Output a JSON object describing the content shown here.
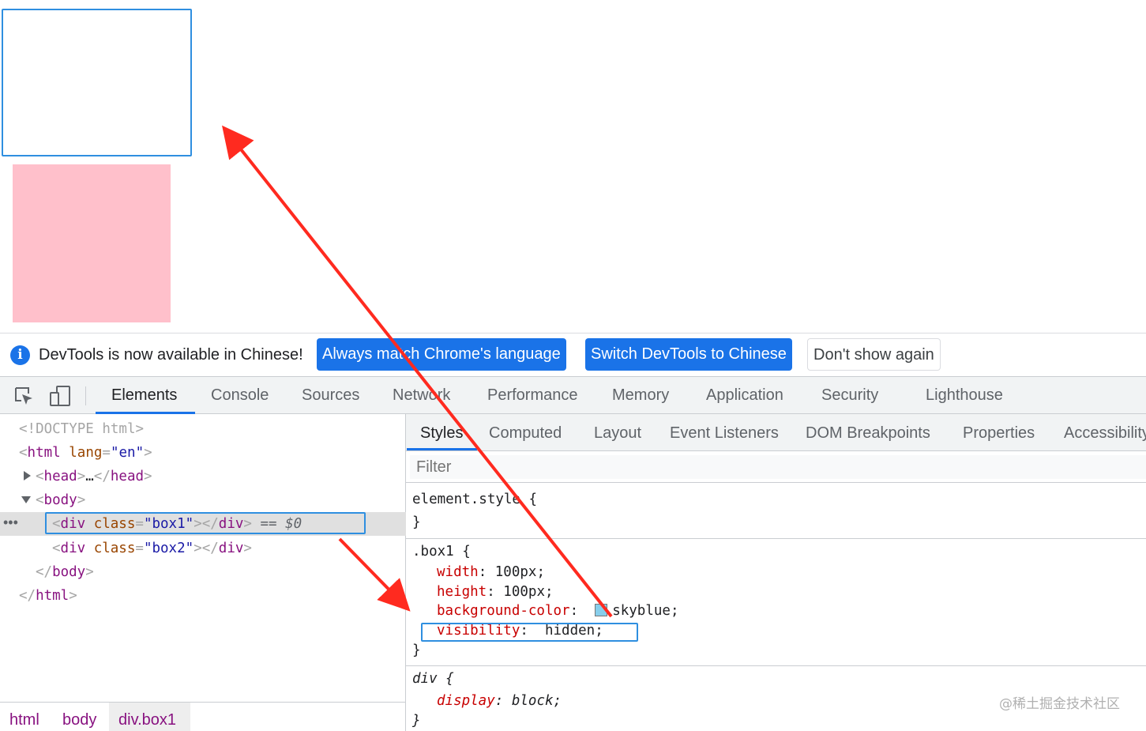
{
  "preview": {
    "box2_color": "#ffc0cb",
    "highlight_color": "#2f8fe0"
  },
  "infobar": {
    "icon": "info-icon",
    "message": "DevTools is now available in Chinese!",
    "btn_match": "Always match Chrome's language",
    "btn_switch": "Switch DevTools to Chinese",
    "btn_dismiss": "Don't show again",
    "primary_color": "#1a73e8"
  },
  "toolbar": {
    "inspect_icon": "inspect-element-icon",
    "device_icon": "device-toolbar-icon",
    "tabs": [
      "Elements",
      "Console",
      "Sources",
      "Network",
      "Performance",
      "Memory",
      "Application",
      "Security",
      "Lighthouse"
    ],
    "active_tab": "Elements",
    "accent_color": "#1a73e8"
  },
  "dom": {
    "doctype": "<!DOCTYPE html>",
    "html_open": {
      "tag": "html",
      "attr": "lang",
      "value": "en"
    },
    "head": {
      "tag": "head",
      "ellipsis": "…"
    },
    "body_open": "body",
    "selected": {
      "tag": "div",
      "attr": "class",
      "value": "box1",
      "marker": "== $0"
    },
    "second": {
      "tag": "div",
      "attr": "class",
      "value": "box2"
    },
    "body_close": "body",
    "html_close": "html",
    "gutter_dots": "•••"
  },
  "breadcrumbs": [
    "html",
    "body",
    "div.box1"
  ],
  "styles": {
    "sub_tabs": [
      "Styles",
      "Computed",
      "Layout",
      "Event Listeners",
      "DOM Breakpoints",
      "Properties",
      "Accessibility"
    ],
    "active_sub_tab": "Styles",
    "filter_placeholder": "Filter",
    "element_style_selector": "element.style",
    "box1": {
      "selector": ".box1",
      "declarations": [
        {
          "prop": "width",
          "value": "100px"
        },
        {
          "prop": "height",
          "value": "100px"
        },
        {
          "prop": "background-color",
          "value": "skyblue",
          "swatch": "#87ceeb"
        },
        {
          "prop": "visibility",
          "value": "hidden"
        }
      ]
    },
    "div_rule": {
      "selector": "div",
      "declarations": [
        {
          "prop": "display",
          "value": "block"
        }
      ]
    },
    "watermark": "@稀土掘金技术社区"
  },
  "annotations": {
    "arrow_color": "#ff2a1f"
  }
}
